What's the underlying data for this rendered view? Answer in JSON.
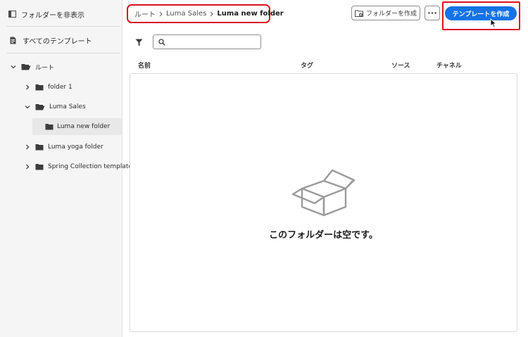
{
  "sidebar": {
    "hide_folders_label": "フォルダーを非表示",
    "all_templates_label": "すべてのテンプレート",
    "tree": {
      "root_label": "ルート",
      "items": [
        {
          "label": "folder 1"
        },
        {
          "label": "Luma Sales"
        },
        {
          "label": "Luma new folder"
        },
        {
          "label": "Luma yoga folder"
        },
        {
          "label": "Spring Collection templates"
        }
      ]
    }
  },
  "breadcrumb": {
    "root": "ルート",
    "parent": "Luma Sales",
    "current": "Luma new folder"
  },
  "toolbar": {
    "create_folder_label": "フォルダーを作成",
    "more_icon": "more-icon",
    "create_template_label": "テンプレートを作成",
    "accent_color": "#1473e6",
    "highlight_color": "#d7141f"
  },
  "search": {
    "placeholder": "",
    "value": ""
  },
  "table": {
    "columns": [
      "名前",
      "タグ",
      "ソース",
      "チャネル"
    ]
  },
  "empty_state": {
    "icon": "open-box-icon",
    "message": "このフォルダーは空です。"
  }
}
